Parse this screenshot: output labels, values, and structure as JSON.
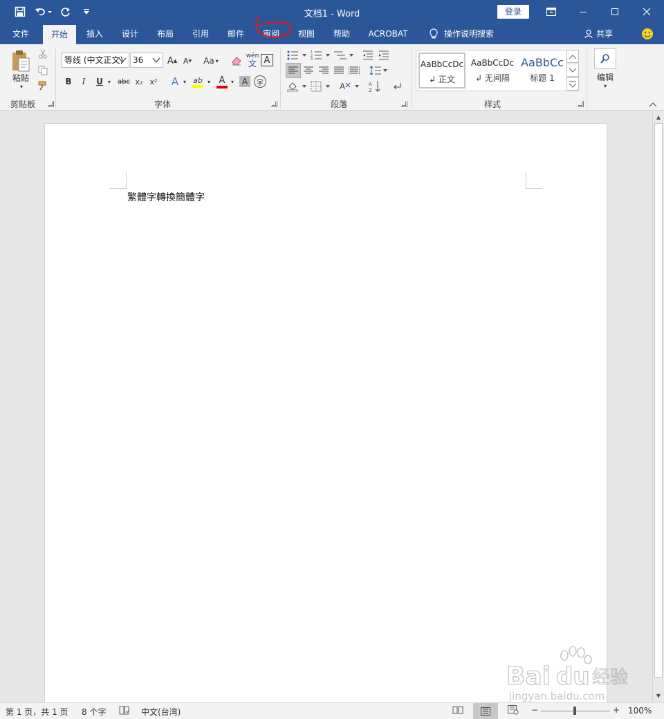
{
  "titlebar": {
    "title": "文档1  -  Word",
    "login": "登录"
  },
  "tabs": [
    {
      "label": "文件"
    },
    {
      "label": "开始"
    },
    {
      "label": "插入"
    },
    {
      "label": "设计"
    },
    {
      "label": "布局"
    },
    {
      "label": "引用"
    },
    {
      "label": "邮件"
    },
    {
      "label": "审阅"
    },
    {
      "label": "视图"
    },
    {
      "label": "帮助"
    },
    {
      "label": "ACROBAT"
    }
  ],
  "tellme": "操作说明搜索",
  "share": "共享",
  "ribbon": {
    "clipboard": {
      "paste": "粘贴",
      "label": "剪贴板"
    },
    "font": {
      "name": "等线 (中文正文)",
      "size": "36",
      "grow": "A",
      "shrink": "A",
      "case": "Aa",
      "pinyin": "wén",
      "pinyin_char": "文",
      "border_char": "A",
      "bold": "B",
      "italic": "I",
      "underline": "U",
      "strike": "abc",
      "sub": "x₂",
      "sup": "x²",
      "effects": "A",
      "highlight": "ab",
      "color": "A",
      "shade": "A",
      "enclose": "字",
      "label": "字体"
    },
    "paragraph": {
      "label": "段落"
    },
    "styles": {
      "label": "样式",
      "items": [
        {
          "sample": "AaBbCcDc",
          "name": "↲ 正文"
        },
        {
          "sample": "AaBbCcDc",
          "name": "↲ 无间隔"
        },
        {
          "sample": "AaBbCc",
          "name": "标题 1"
        }
      ]
    },
    "editing": {
      "label": "编辑"
    }
  },
  "document": {
    "text": "繁體字轉換簡體字"
  },
  "status": {
    "page": "第 1 页，共 1 页",
    "words": "8 个字",
    "language": "中文(台湾)",
    "zoom": "100%",
    "zoom_minus": "−",
    "zoom_plus": "+"
  },
  "watermark": {
    "brand": "Bai du 经验",
    "url": "jingyan.baidu.com"
  },
  "colors": {
    "brand": "#2b579a",
    "highlight": "#ffff00",
    "font_color": "#e00000",
    "annotation": "#e0191e"
  }
}
